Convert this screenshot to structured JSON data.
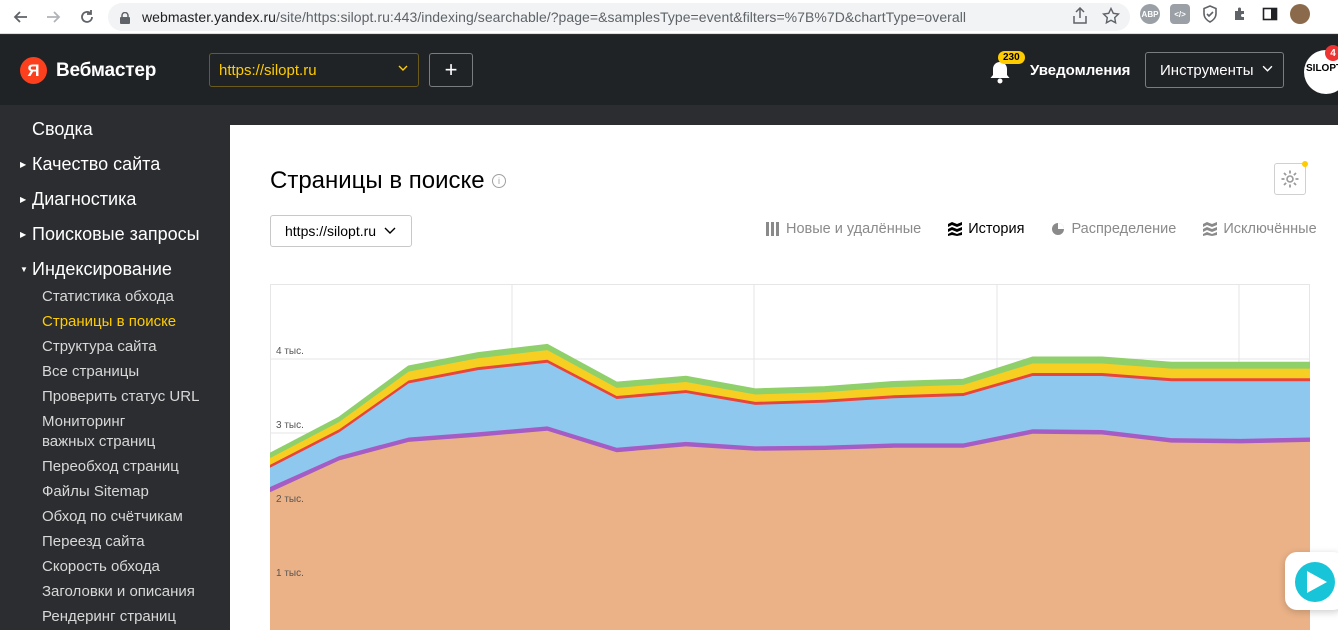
{
  "browser": {
    "url_host": "webmaster.yandex.ru",
    "url_path": "/site/https:silopt.ru:443/indexing/searchable/?page=&samplesType=event&filters=%7B%7D&chartType=overall",
    "extensions": [
      "ABP",
      "</>"
    ]
  },
  "header": {
    "logo_letter": "Я",
    "logo_text": "Вебмастер",
    "site": "https://silopt.ru",
    "add_label": "+",
    "notif_count": "230",
    "notif_label": "Уведомления",
    "tools_label": "Инструменты",
    "avatar_text": "SILOPT",
    "avatar_badge": "4"
  },
  "sidebar": {
    "top_items": [
      {
        "label": "Сводка"
      },
      {
        "label": "Качество сайта"
      },
      {
        "label": "Диагностика"
      },
      {
        "label": "Поисковые запросы"
      },
      {
        "label": "Индексирование"
      }
    ],
    "sub_items": [
      {
        "label": "Статистика обхода"
      },
      {
        "label": "Страницы в поиске"
      },
      {
        "label": "Структура сайта"
      },
      {
        "label": "Все страницы"
      },
      {
        "label": "Проверить статус URL"
      },
      {
        "label": "Мониторинг"
      },
      {
        "label": "важных страниц"
      },
      {
        "label": "Переобход страниц"
      },
      {
        "label": "Файлы Sitemap"
      },
      {
        "label": "Обход по счётчикам"
      },
      {
        "label": "Переезд сайта"
      },
      {
        "label": "Скорость обхода"
      },
      {
        "label": "Заголовки и описания"
      },
      {
        "label": "Рендеринг страниц"
      }
    ]
  },
  "main": {
    "title": "Страницы в поиске",
    "info_icon": "i",
    "host": "https://silopt.ru",
    "tabs": [
      {
        "label": "Новые и удалённые",
        "icon": "bars-icon"
      },
      {
        "label": "История",
        "icon": "history-icon"
      },
      {
        "label": "Распределение",
        "icon": "pie-icon"
      },
      {
        "label": "Исключённые",
        "icon": "excluded-icon"
      }
    ]
  },
  "chart_data": {
    "type": "area",
    "y_tick_labels": [
      "1 тыс.",
      "2 тыс.",
      "3 тыс.",
      "4 тыс."
    ],
    "ylim": [
      0,
      4000
    ],
    "grid": true,
    "x": [
      0,
      1,
      2,
      3,
      4,
      5,
      6,
      7,
      8,
      9,
      10,
      11,
      12,
      13,
      14,
      15
    ],
    "series": [
      {
        "color": "#ebb287",
        "values": [
          2200,
          2630,
          2880,
          2950,
          3030,
          2740,
          2820,
          2760,
          2770,
          2800,
          2800,
          2990,
          2980,
          2870,
          2860,
          2880
        ]
      },
      {
        "color": "#a55cc4",
        "values": [
          70,
          60,
          60,
          60,
          60,
          60,
          60,
          60,
          60,
          60,
          60,
          60,
          60,
          60,
          60,
          60
        ]
      },
      {
        "color": "#8fc8ee",
        "values": [
          260,
          320,
          730,
          840,
          860,
          660,
          660,
          560,
          580,
          610,
          640,
          720,
          730,
          770,
          780,
          760
        ]
      },
      {
        "color": "#e8453c",
        "values": [
          40,
          40,
          40,
          40,
          40,
          40,
          40,
          40,
          40,
          40,
          40,
          40,
          40,
          40,
          40,
          40
        ]
      },
      {
        "color": "#f7cf22",
        "values": [
          90,
          100,
          120,
          120,
          130,
          110,
          110,
          100,
          100,
          110,
          110,
          130,
          130,
          130,
          130,
          130
        ]
      },
      {
        "color": "#8fd06a",
        "values": [
          60,
          60,
          70,
          70,
          70,
          70,
          70,
          70,
          70,
          70,
          70,
          80,
          80,
          80,
          80,
          80
        ]
      }
    ]
  }
}
